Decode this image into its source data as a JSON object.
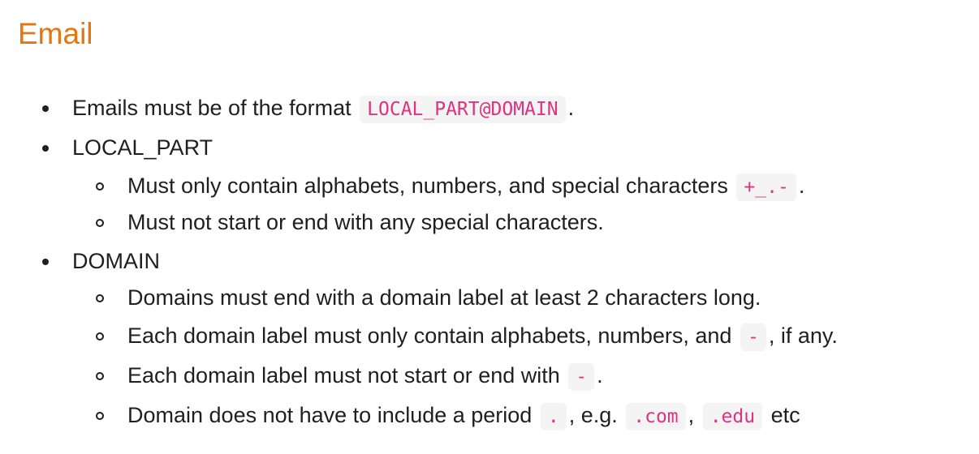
{
  "title": "Email",
  "items": [
    {
      "before": "Emails must be of the format",
      "code": "LOCAL_PART@DOMAIN",
      "after": "."
    },
    {
      "label": "LOCAL_PART",
      "children": [
        {
          "before": "Must only contain alphabets, numbers, and special characters",
          "code": "+_.-",
          "after": "."
        },
        {
          "text": "Must not start or end with any special characters."
        }
      ]
    },
    {
      "label": "DOMAIN",
      "children": [
        {
          "text": "Domains must end with a domain label at least 2 characters long."
        },
        {
          "before": "Each domain label must only contain alphabets, numbers, and",
          "code": "-",
          "after": ", if any."
        },
        {
          "before": "Each domain label must not start or end with",
          "code": "-",
          "after": "."
        },
        {
          "before": "Domain does not have to include a period",
          "code": ".",
          "middle": ", e.g.",
          "code2": ".com",
          "middle2": ",",
          "code3": ".edu",
          "after": "etc"
        }
      ]
    }
  ]
}
